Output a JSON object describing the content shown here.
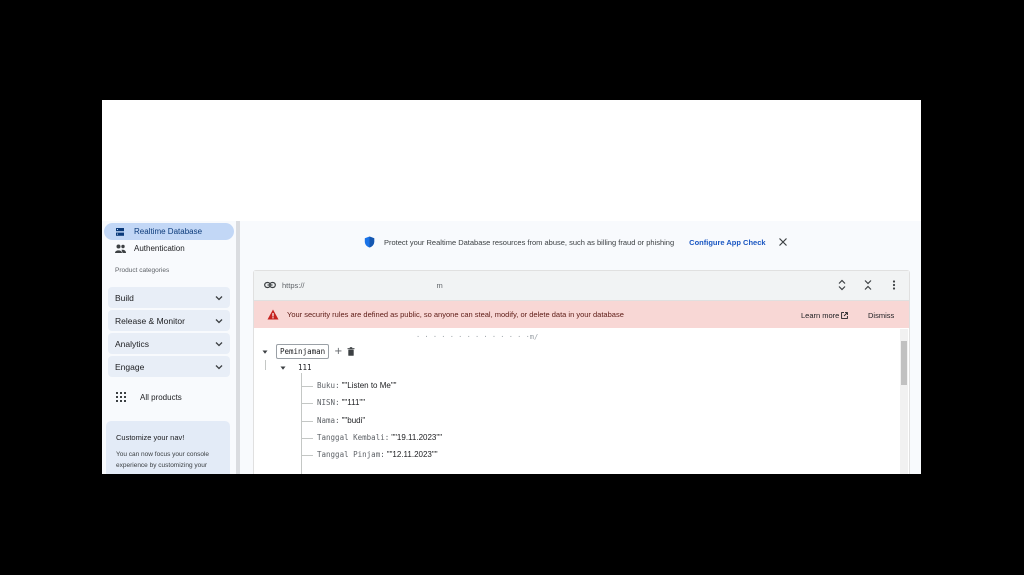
{
  "sidebar": {
    "items": [
      {
        "label": "Realtime Database",
        "icon": "database-icon",
        "active": true
      },
      {
        "label": "Authentication",
        "icon": "people-icon",
        "active": false
      }
    ],
    "categories_label": "Product categories",
    "categories": [
      {
        "label": "Build"
      },
      {
        "label": "Release & Monitor"
      },
      {
        "label": "Analytics"
      },
      {
        "label": "Engage"
      }
    ],
    "all_products": "All products",
    "customize": {
      "title": "Customize your nav!",
      "description": "You can now focus your console experience by customizing your"
    }
  },
  "banner": {
    "message": "Protect your Realtime Database resources from abuse, such as billing fraud or phishing",
    "action": "Configure App Check"
  },
  "database": {
    "url_prefix": "https://",
    "url_suffix": "m",
    "warning": "Your security rules are defined as public, so anyone can steal, modify, or delete data in your database",
    "learn_more": "Learn more",
    "dismiss": "Dismiss",
    "faded_url": "·  ·  ·  ·    ·  ·  ·  ·  ·  ·    ·  ·  ·  ·m/",
    "root_key": "Peminjaman",
    "child_key": "111",
    "fields": [
      {
        "key": "Buku",
        "value": "\"\"Listen to Me\"\""
      },
      {
        "key": "NISN",
        "value": "\"\"111\"\""
      },
      {
        "key": "Nama",
        "value": "\"\"budi\""
      },
      {
        "key": "Tanggal Kembali",
        "value": "\"\"19.11.2023\"\""
      },
      {
        "key": "Tanggal Pinjam",
        "value": "\"\"12.11.2023\"\""
      }
    ]
  },
  "colors": {
    "active_nav": "#c2d7f6",
    "link_blue": "#1a57c2",
    "warning_bg": "#f8d7d5",
    "warning_icon": "#c5221f",
    "shield": "#1a73e8"
  }
}
